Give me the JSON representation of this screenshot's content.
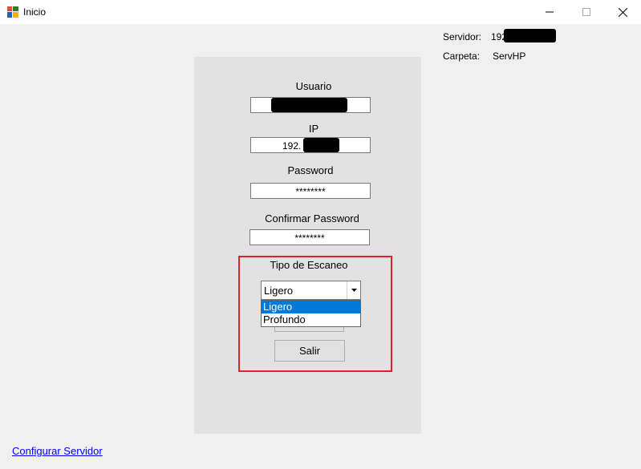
{
  "window": {
    "title": "Inicio",
    "icon": "windows-forms-app-icon",
    "controls": [
      "minimize-icon",
      "maximize-icon",
      "close-icon"
    ]
  },
  "server_info": {
    "server_label": "Servidor:",
    "server_value": "192.",
    "folder_label": "Carpeta:",
    "folder_value": "ServHP"
  },
  "form": {
    "usuario_label": "Usuario",
    "usuario_value": "",
    "ip_label": "IP",
    "ip_value": "192.",
    "password_label": "Password",
    "password_value": "********",
    "confirm_label": "Confirmar Password",
    "confirm_value": "********",
    "scan_type_label": "Tipo de Escaneo",
    "scan_type_selected": "Ligero",
    "scan_type_options": [
      "Ligero",
      "Profundo"
    ],
    "salir_label": "Salir"
  },
  "footer": {
    "configure_link": "Configurar Servidor"
  },
  "colors": {
    "window_bg": "#f0f0f0",
    "panel_bg": "#e2e2e2",
    "highlight_border": "#e0202a",
    "selection": "#0078d7",
    "link": "#0000ee"
  }
}
